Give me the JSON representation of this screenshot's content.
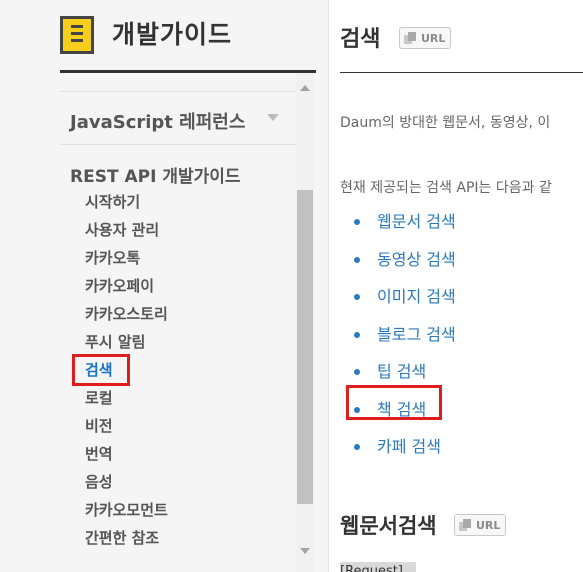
{
  "sidebar": {
    "title": "개발가이드",
    "js_reference": "JavaScript 레퍼런스",
    "rest_title": "REST API 개발가이드",
    "items": [
      "시작하기",
      "사용자 관리",
      "카카오톡",
      "카카오페이",
      "카카오스토리",
      "푸시 알림",
      "검색",
      "로컬",
      "비전",
      "번역",
      "음성",
      "카카오모먼트",
      "간편한 참조"
    ],
    "active_item": "검색"
  },
  "main": {
    "page_title": "검색",
    "url_badge": "URL",
    "intro": "Daum의 방대한 웹문서, 동영상, 이",
    "intro2": "현재 제공되는 검색 API는 다음과 같",
    "links": [
      "웹문서 검색",
      "동영상 검색",
      "이미지 검색",
      "블로그 검색",
      "팁 검색",
      "책 검색",
      "카페 검색"
    ],
    "highlighted_link": "책 검색",
    "section_title": "웹문서검색",
    "section_badge": "URL",
    "request_label": "[Request]"
  },
  "colors": {
    "accent_link": "#2a79c1",
    "highlight_box": "#e01d1d",
    "logo_yellow": "#f6cf1d"
  },
  "icons": [
    "logo-icon",
    "chevron-down-icon",
    "copy-icon"
  ]
}
